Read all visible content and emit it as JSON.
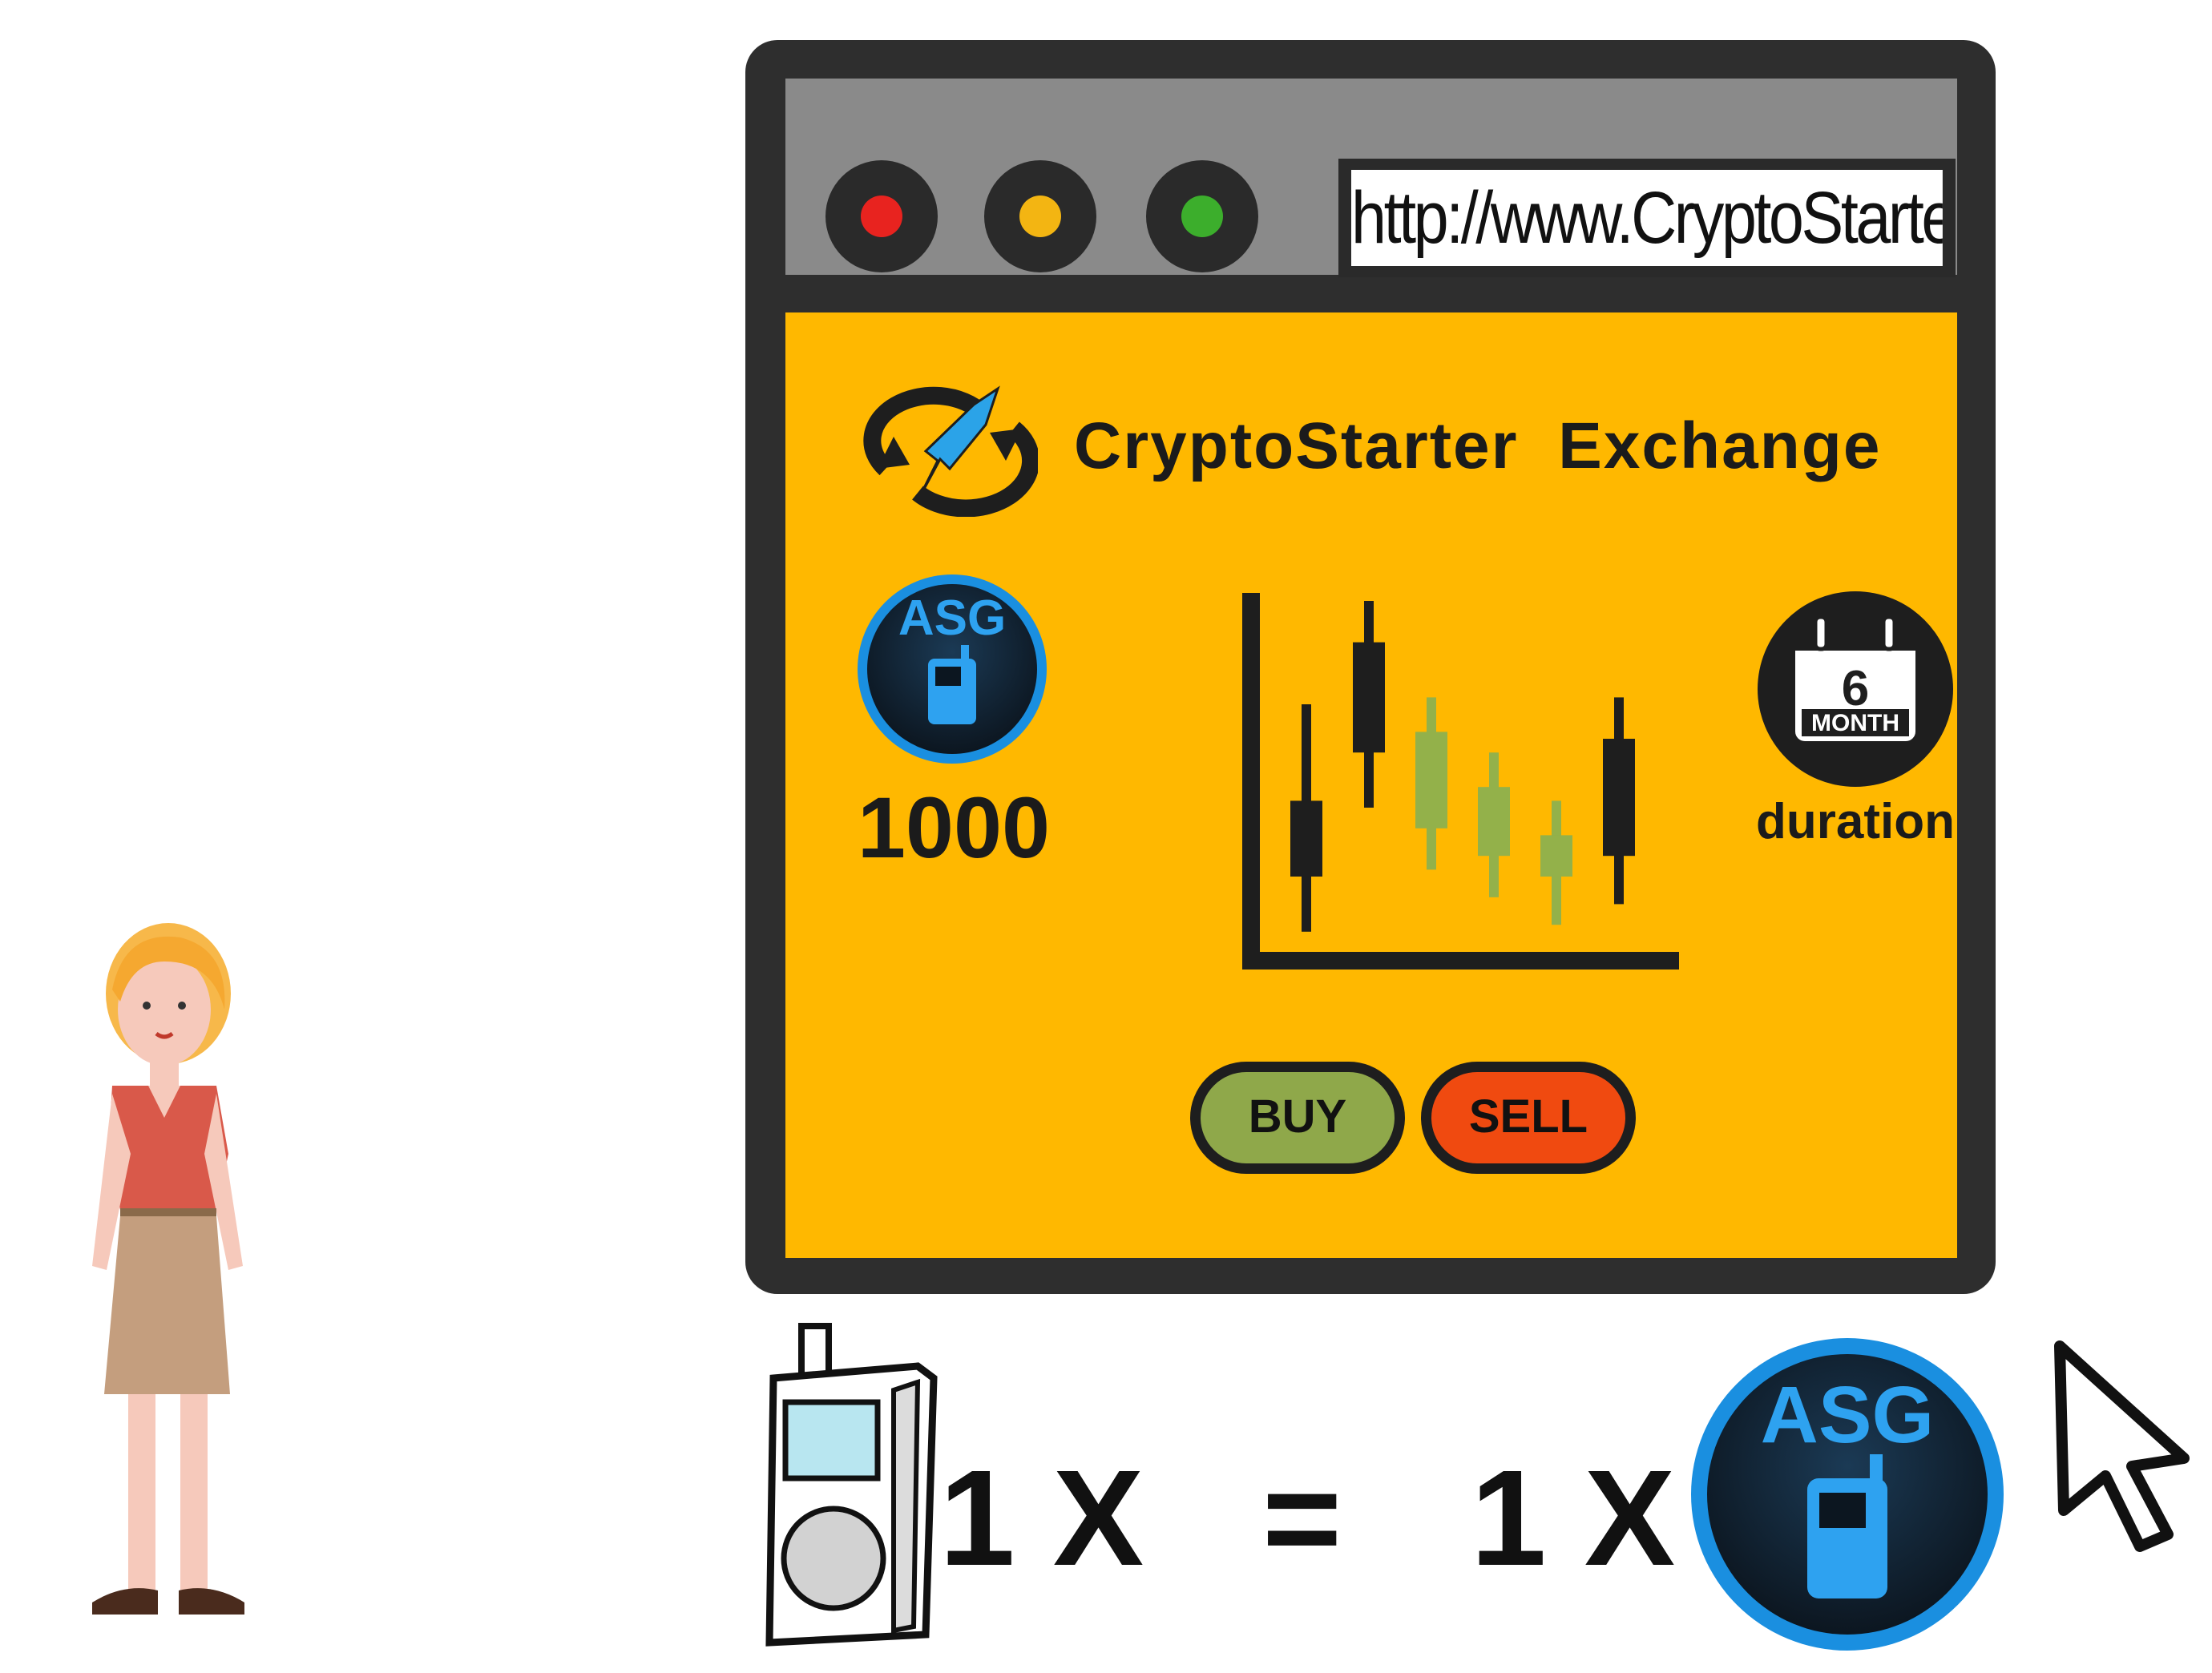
{
  "browser": {
    "url": "http://www.CryptoStarter.io",
    "traffic_lights": {
      "close": "#e8231f",
      "minimize": "#f3b512",
      "maximize": "#3cae2c"
    }
  },
  "exchange": {
    "title": "CryptoStarter  Exchange",
    "asset_badge": "ASG",
    "balance": "1000",
    "duration_icon_number": "6",
    "duration_icon_text": "MONTH",
    "duration_label": "duration",
    "buy_label": "BUY",
    "sell_label": "SELL"
  },
  "equation": {
    "lhs": "1 X",
    "equals": "=",
    "rhs": "1 X",
    "token_label": "ASG"
  },
  "colors": {
    "accent": "#ffb800",
    "buy": "#8fa84a",
    "sell": "#f04a10",
    "token_blue": "#1a8fe0"
  },
  "chart_data": {
    "type": "candlestick",
    "candles": [
      {
        "open": 0.42,
        "close": 0.2,
        "high": 0.7,
        "low": 0.04,
        "color": "dark"
      },
      {
        "open": 0.88,
        "close": 0.56,
        "high": 1.0,
        "low": 0.4,
        "color": "dark"
      },
      {
        "open": 0.62,
        "close": 0.34,
        "high": 0.72,
        "low": 0.22,
        "color": "green"
      },
      {
        "open": 0.46,
        "close": 0.26,
        "high": 0.56,
        "low": 0.14,
        "color": "green"
      },
      {
        "open": 0.32,
        "close": 0.2,
        "high": 0.42,
        "low": 0.06,
        "color": "green"
      },
      {
        "open": 0.6,
        "close": 0.26,
        "high": 0.72,
        "low": 0.12,
        "color": "dark"
      }
    ]
  }
}
